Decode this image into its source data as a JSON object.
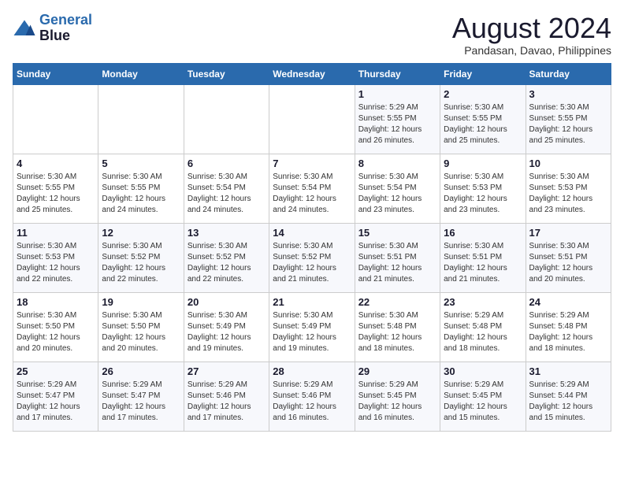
{
  "header": {
    "logo_line1": "General",
    "logo_line2": "Blue",
    "month": "August 2024",
    "location": "Pandasan, Davao, Philippines"
  },
  "days_of_week": [
    "Sunday",
    "Monday",
    "Tuesday",
    "Wednesday",
    "Thursday",
    "Friday",
    "Saturday"
  ],
  "weeks": [
    [
      {
        "day": "",
        "info": ""
      },
      {
        "day": "",
        "info": ""
      },
      {
        "day": "",
        "info": ""
      },
      {
        "day": "",
        "info": ""
      },
      {
        "day": "1",
        "info": "Sunrise: 5:29 AM\nSunset: 5:55 PM\nDaylight: 12 hours\nand 26 minutes."
      },
      {
        "day": "2",
        "info": "Sunrise: 5:30 AM\nSunset: 5:55 PM\nDaylight: 12 hours\nand 25 minutes."
      },
      {
        "day": "3",
        "info": "Sunrise: 5:30 AM\nSunset: 5:55 PM\nDaylight: 12 hours\nand 25 minutes."
      }
    ],
    [
      {
        "day": "4",
        "info": "Sunrise: 5:30 AM\nSunset: 5:55 PM\nDaylight: 12 hours\nand 25 minutes."
      },
      {
        "day": "5",
        "info": "Sunrise: 5:30 AM\nSunset: 5:55 PM\nDaylight: 12 hours\nand 24 minutes."
      },
      {
        "day": "6",
        "info": "Sunrise: 5:30 AM\nSunset: 5:54 PM\nDaylight: 12 hours\nand 24 minutes."
      },
      {
        "day": "7",
        "info": "Sunrise: 5:30 AM\nSunset: 5:54 PM\nDaylight: 12 hours\nand 24 minutes."
      },
      {
        "day": "8",
        "info": "Sunrise: 5:30 AM\nSunset: 5:54 PM\nDaylight: 12 hours\nand 23 minutes."
      },
      {
        "day": "9",
        "info": "Sunrise: 5:30 AM\nSunset: 5:53 PM\nDaylight: 12 hours\nand 23 minutes."
      },
      {
        "day": "10",
        "info": "Sunrise: 5:30 AM\nSunset: 5:53 PM\nDaylight: 12 hours\nand 23 minutes."
      }
    ],
    [
      {
        "day": "11",
        "info": "Sunrise: 5:30 AM\nSunset: 5:53 PM\nDaylight: 12 hours\nand 22 minutes."
      },
      {
        "day": "12",
        "info": "Sunrise: 5:30 AM\nSunset: 5:52 PM\nDaylight: 12 hours\nand 22 minutes."
      },
      {
        "day": "13",
        "info": "Sunrise: 5:30 AM\nSunset: 5:52 PM\nDaylight: 12 hours\nand 22 minutes."
      },
      {
        "day": "14",
        "info": "Sunrise: 5:30 AM\nSunset: 5:52 PM\nDaylight: 12 hours\nand 21 minutes."
      },
      {
        "day": "15",
        "info": "Sunrise: 5:30 AM\nSunset: 5:51 PM\nDaylight: 12 hours\nand 21 minutes."
      },
      {
        "day": "16",
        "info": "Sunrise: 5:30 AM\nSunset: 5:51 PM\nDaylight: 12 hours\nand 21 minutes."
      },
      {
        "day": "17",
        "info": "Sunrise: 5:30 AM\nSunset: 5:51 PM\nDaylight: 12 hours\nand 20 minutes."
      }
    ],
    [
      {
        "day": "18",
        "info": "Sunrise: 5:30 AM\nSunset: 5:50 PM\nDaylight: 12 hours\nand 20 minutes."
      },
      {
        "day": "19",
        "info": "Sunrise: 5:30 AM\nSunset: 5:50 PM\nDaylight: 12 hours\nand 20 minutes."
      },
      {
        "day": "20",
        "info": "Sunrise: 5:30 AM\nSunset: 5:49 PM\nDaylight: 12 hours\nand 19 minutes."
      },
      {
        "day": "21",
        "info": "Sunrise: 5:30 AM\nSunset: 5:49 PM\nDaylight: 12 hours\nand 19 minutes."
      },
      {
        "day": "22",
        "info": "Sunrise: 5:30 AM\nSunset: 5:48 PM\nDaylight: 12 hours\nand 18 minutes."
      },
      {
        "day": "23",
        "info": "Sunrise: 5:29 AM\nSunset: 5:48 PM\nDaylight: 12 hours\nand 18 minutes."
      },
      {
        "day": "24",
        "info": "Sunrise: 5:29 AM\nSunset: 5:48 PM\nDaylight: 12 hours\nand 18 minutes."
      }
    ],
    [
      {
        "day": "25",
        "info": "Sunrise: 5:29 AM\nSunset: 5:47 PM\nDaylight: 12 hours\nand 17 minutes."
      },
      {
        "day": "26",
        "info": "Sunrise: 5:29 AM\nSunset: 5:47 PM\nDaylight: 12 hours\nand 17 minutes."
      },
      {
        "day": "27",
        "info": "Sunrise: 5:29 AM\nSunset: 5:46 PM\nDaylight: 12 hours\nand 17 minutes."
      },
      {
        "day": "28",
        "info": "Sunrise: 5:29 AM\nSunset: 5:46 PM\nDaylight: 12 hours\nand 16 minutes."
      },
      {
        "day": "29",
        "info": "Sunrise: 5:29 AM\nSunset: 5:45 PM\nDaylight: 12 hours\nand 16 minutes."
      },
      {
        "day": "30",
        "info": "Sunrise: 5:29 AM\nSunset: 5:45 PM\nDaylight: 12 hours\nand 15 minutes."
      },
      {
        "day": "31",
        "info": "Sunrise: 5:29 AM\nSunset: 5:44 PM\nDaylight: 12 hours\nand 15 minutes."
      }
    ]
  ]
}
